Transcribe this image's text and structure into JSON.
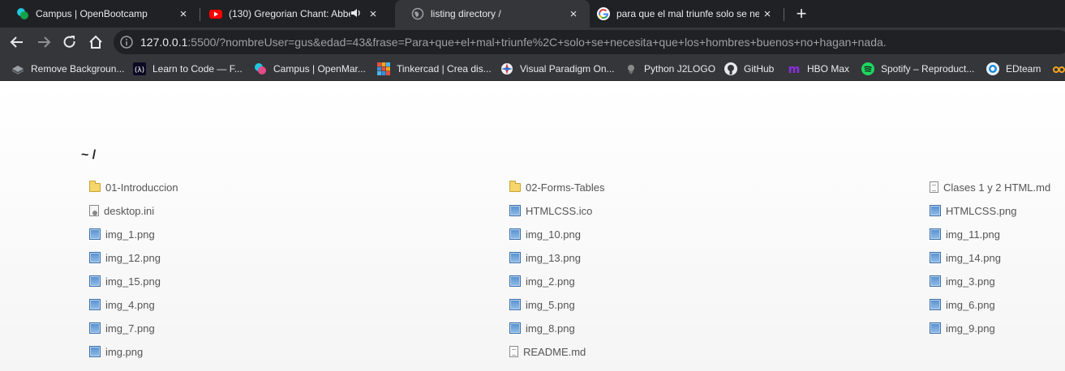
{
  "tabs": [
    {
      "title": "Campus | OpenBootcamp",
      "close": "×",
      "active": false
    },
    {
      "title": "(130) Gregorian Chant: Abbe",
      "close": "×",
      "active": false
    },
    {
      "title": "listing directory /",
      "close": "×",
      "active": true
    },
    {
      "title": "para que el mal triunfe solo se ne",
      "close": "×",
      "active": false
    }
  ],
  "new_tab": "+",
  "address_bar": {
    "host": "127.0.0.1",
    "rest": ":5500/?nombreUser=gus&edad=43&frase=Para+que+el+mal+triunfe%2C+solo+se+necesita+que+los+hombres+buenos+no+hagan+nada."
  },
  "bookmarks": [
    {
      "label": "Remove Backgroun...",
      "icon": "layers-icon"
    },
    {
      "label": "Learn to Code — F...",
      "icon": "freecodecamp-icon"
    },
    {
      "label": "Campus | OpenMar...",
      "icon": "openbootcamp-icon"
    },
    {
      "label": "Tinkercad | Crea dis...",
      "icon": "tinkercad-icon"
    },
    {
      "label": "Visual Paradigm On...",
      "icon": "visual-paradigm-icon"
    },
    {
      "label": "Python J2LOGO",
      "icon": "python-icon"
    },
    {
      "label": "GitHub",
      "icon": "github-icon"
    },
    {
      "label": "HBO Max",
      "icon": "hbo-max-icon"
    },
    {
      "label": "Spotify – Reproduct...",
      "icon": "spotify-icon"
    },
    {
      "label": "EDteam",
      "icon": "edteam-icon"
    }
  ],
  "listing": {
    "heading": "~ /",
    "files": [
      {
        "name": "01-Introduccion",
        "type": "folder"
      },
      {
        "name": "02-Forms-Tables",
        "type": "folder"
      },
      {
        "name": "Clases 1 y 2 HTML.md",
        "type": "doc"
      },
      {
        "name": "desktop.ini",
        "type": "settings"
      },
      {
        "name": "HTMLCSS.ico",
        "type": "image"
      },
      {
        "name": "HTMLCSS.png",
        "type": "image"
      },
      {
        "name": "img_1.png",
        "type": "image"
      },
      {
        "name": "img_10.png",
        "type": "image"
      },
      {
        "name": "img_11.png",
        "type": "image"
      },
      {
        "name": "img_12.png",
        "type": "image"
      },
      {
        "name": "img_13.png",
        "type": "image"
      },
      {
        "name": "img_14.png",
        "type": "image"
      },
      {
        "name": "img_15.png",
        "type": "image"
      },
      {
        "name": "img_2.png",
        "type": "image"
      },
      {
        "name": "img_3.png",
        "type": "image"
      },
      {
        "name": "img_4.png",
        "type": "image"
      },
      {
        "name": "img_5.png",
        "type": "image"
      },
      {
        "name": "img_6.png",
        "type": "image"
      },
      {
        "name": "img_7.png",
        "type": "image"
      },
      {
        "name": "img_8.png",
        "type": "image"
      },
      {
        "name": "img_9.png",
        "type": "image"
      },
      {
        "name": "img.png",
        "type": "image"
      },
      {
        "name": "README.md",
        "type": "doc"
      }
    ]
  }
}
